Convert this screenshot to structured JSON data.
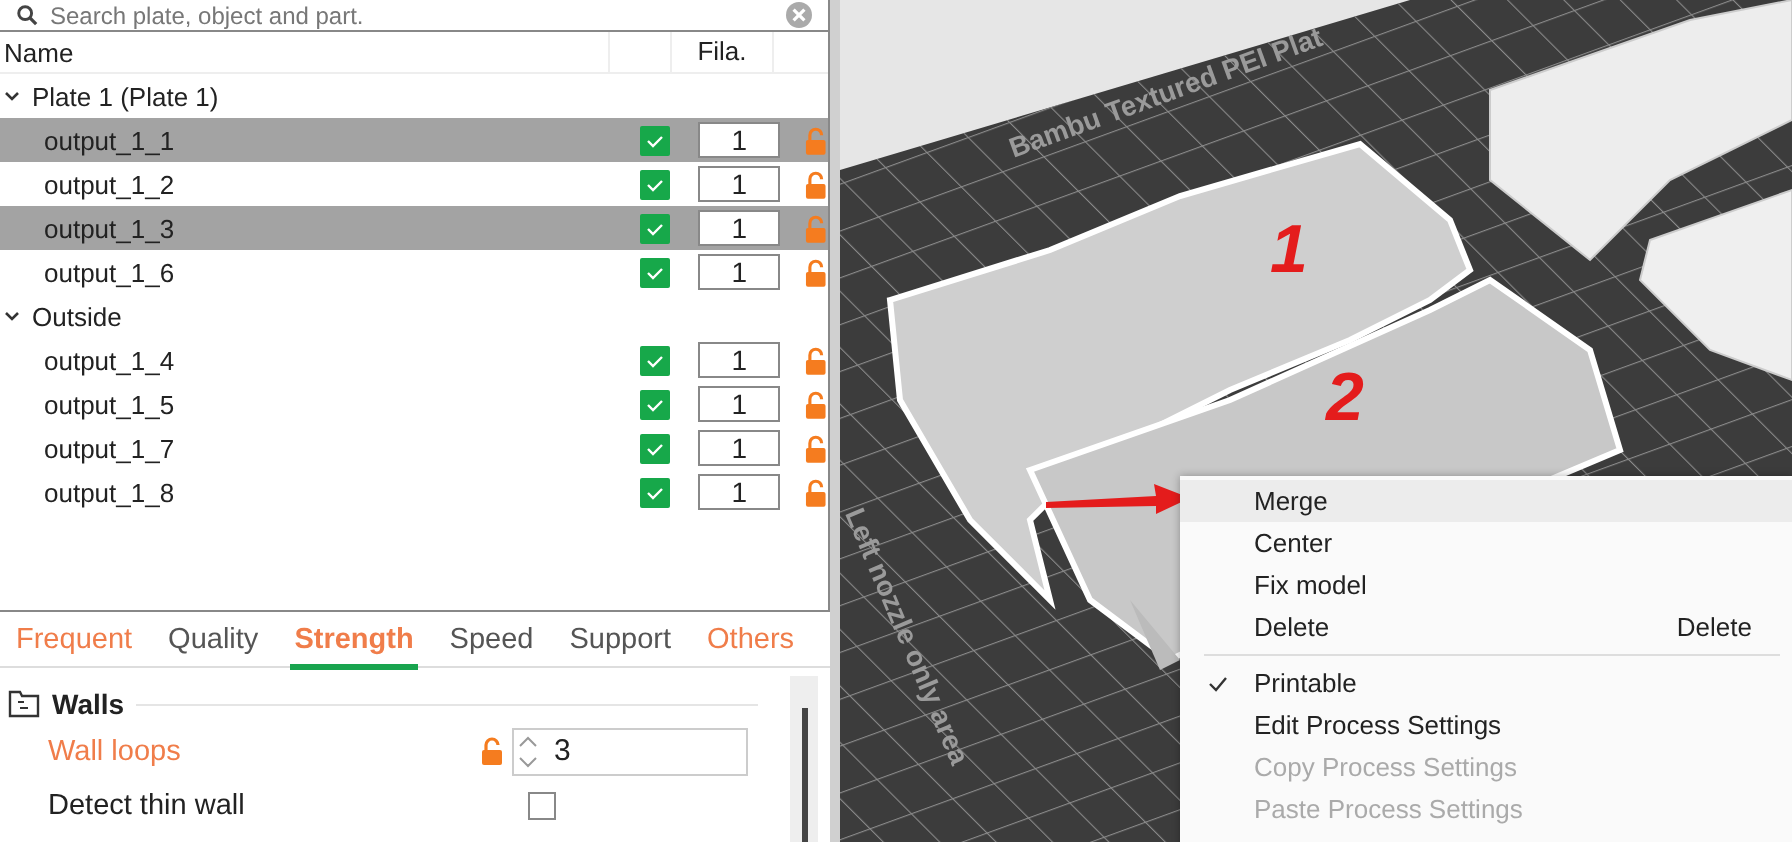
{
  "object_list": {
    "search": {
      "placeholder": "Search plate, object and part."
    },
    "columns": {
      "name": "Name",
      "filament": "Fila."
    },
    "groups": [
      {
        "name": "Plate 1 (Plate 1)",
        "expanded": true,
        "children": [
          {
            "name": "output_1_1",
            "selected": true,
            "printable": true,
            "filament": "1"
          },
          {
            "name": "output_1_2",
            "selected": false,
            "printable": true,
            "filament": "1"
          },
          {
            "name": "output_1_3",
            "selected": true,
            "printable": true,
            "filament": "1"
          },
          {
            "name": "output_1_6",
            "selected": false,
            "printable": true,
            "filament": "1"
          }
        ]
      },
      {
        "name": "Outside",
        "expanded": true,
        "children": [
          {
            "name": "output_1_4",
            "selected": false,
            "printable": true,
            "filament": "1"
          },
          {
            "name": "output_1_5",
            "selected": false,
            "printable": true,
            "filament": "1"
          },
          {
            "name": "output_1_7",
            "selected": false,
            "printable": true,
            "filament": "1"
          },
          {
            "name": "output_1_8",
            "selected": false,
            "printable": true,
            "filament": "1"
          }
        ]
      }
    ]
  },
  "settings_tabs": [
    {
      "label": "Frequent",
      "selected": false,
      "modified": true
    },
    {
      "label": "Quality",
      "selected": false,
      "modified": false
    },
    {
      "label": "Strength",
      "selected": true,
      "modified": true
    },
    {
      "label": "Speed",
      "selected": false,
      "modified": false
    },
    {
      "label": "Support",
      "selected": false,
      "modified": false
    },
    {
      "label": "Others",
      "selected": false,
      "modified": true
    }
  ],
  "settings": {
    "section": "Walls",
    "rows": [
      {
        "kind": "spinner",
        "label": "Wall loops",
        "modified": true,
        "value": "3"
      },
      {
        "kind": "checkbox",
        "label": "Detect thin wall",
        "modified": false,
        "checked": false
      }
    ]
  },
  "viewport": {
    "plate_label": "Bambu Textured PEI Plat",
    "area_label": "Left nozzle only area",
    "annotations": [
      "1",
      "2"
    ]
  },
  "context_menu": {
    "groups": [
      [
        {
          "label": "Merge",
          "highlighted": true,
          "checked": false,
          "disabled": false
        },
        {
          "label": "Center",
          "highlighted": false,
          "checked": false,
          "disabled": false
        },
        {
          "label": "Fix model",
          "highlighted": false,
          "checked": false,
          "disabled": false
        },
        {
          "label": "Delete",
          "shortcut": "Delete",
          "highlighted": false,
          "checked": false,
          "disabled": false
        }
      ],
      [
        {
          "label": "Printable",
          "highlighted": false,
          "checked": true,
          "disabled": false
        },
        {
          "label": "Edit Process Settings",
          "highlighted": false,
          "checked": false,
          "disabled": false
        },
        {
          "label": "Copy Process Settings",
          "highlighted": false,
          "checked": false,
          "disabled": true
        },
        {
          "label": "Paste Process Settings",
          "highlighted": false,
          "checked": false,
          "disabled": true
        }
      ]
    ]
  }
}
